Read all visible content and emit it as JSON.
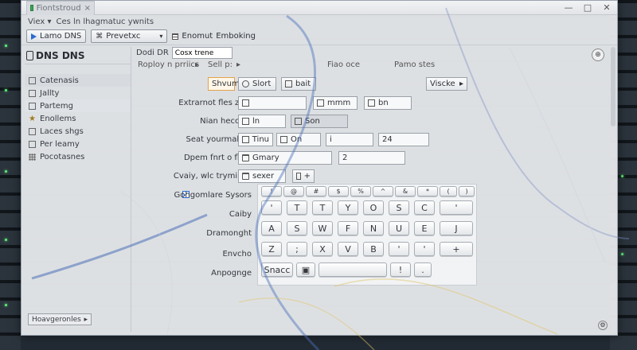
{
  "window": {
    "tab_title": "Fiontstroud",
    "tab_close": "×",
    "controls": {
      "minimize": "—",
      "maximize": "□",
      "close": "✕"
    }
  },
  "menubar": {
    "items": [
      "Viex ▾",
      "Ces ln lhagmatuc ywnits"
    ]
  },
  "toolbar": {
    "run_label": "Lamo DNS",
    "preview_label": "Prevetxc",
    "preview_caret": "▾",
    "enroll_label": "Enomut",
    "emboking_label": "Emboking"
  },
  "sidebar": {
    "title": "DNS DNS",
    "items": [
      {
        "label": "Catenasis",
        "icon": "list-icon"
      },
      {
        "label": "Jallty",
        "icon": "doc-icon"
      },
      {
        "label": "Partemg",
        "icon": "doc-icon"
      },
      {
        "label": "Enollems",
        "icon": "star-icon"
      },
      {
        "label": "Laces shgs",
        "icon": "doc-icon"
      },
      {
        "label": "Per leamy",
        "icon": "doc-icon"
      },
      {
        "label": "Pocotasnes",
        "icon": "grid-icon"
      }
    ],
    "footer_label": "Hoavgeronles",
    "footer_caret": "▸"
  },
  "content": {
    "header_label": "Dodi DR",
    "header_value": "Cosx trene",
    "subheader": {
      "left": "Roploy n prriics",
      "caret_left": "▸",
      "sell": "Sell p:",
      "caret_sell": "▸",
      "mid": "Fiao oce",
      "right": "Pamo stes"
    },
    "zoom_icon_label": "⊕",
    "rows": [
      {
        "label": "",
        "fields": [
          "Shvume",
          "Slort",
          "bait",
          "Viscke"
        ]
      },
      {
        "label": "Extrarnot fles zbtc",
        "fields": [
          "",
          "mmm",
          "bn"
        ]
      },
      {
        "label": "Nian heccers",
        "fields": [
          "ln",
          "Son"
        ]
      },
      {
        "label": "Seat yourmaklyr",
        "fields": [
          "Tinu",
          "On",
          "i",
          "24"
        ]
      },
      {
        "label": "Dpem fnrt o fline",
        "fields": [
          "Gmary",
          "2"
        ]
      },
      {
        "label": "Cvaiy, wlc trymings",
        "fields": [
          "sexer",
          "+"
        ]
      },
      {
        "label": "Gohgomlare Sysors",
        "fields": []
      },
      {
        "label": "Caiby",
        "fields": []
      },
      {
        "label": "Dramonght",
        "fields": []
      },
      {
        "label": "Envcho",
        "fields": []
      },
      {
        "label": "Anpognge",
        "fields": []
      }
    ],
    "checkbox_mark": "✓",
    "view_caret": "▸"
  },
  "keyboard": {
    "row0": [
      "!",
      "@",
      "#",
      "$",
      "%",
      "^",
      "&",
      "*",
      "(",
      ")"
    ],
    "row1": [
      "'",
      "T",
      "T",
      "Y",
      "O",
      "S",
      "C",
      "'"
    ],
    "row2": [
      "A",
      "S",
      "W",
      "F",
      "N",
      "U",
      "E",
      "J"
    ],
    "row3": [
      "Z",
      ";",
      "X",
      "V",
      "B",
      "'",
      "'",
      "+"
    ],
    "row4": [
      "Snacc",
      "",
      "",
      "!",
      "."
    ]
  },
  "corner_icon": "⚙"
}
